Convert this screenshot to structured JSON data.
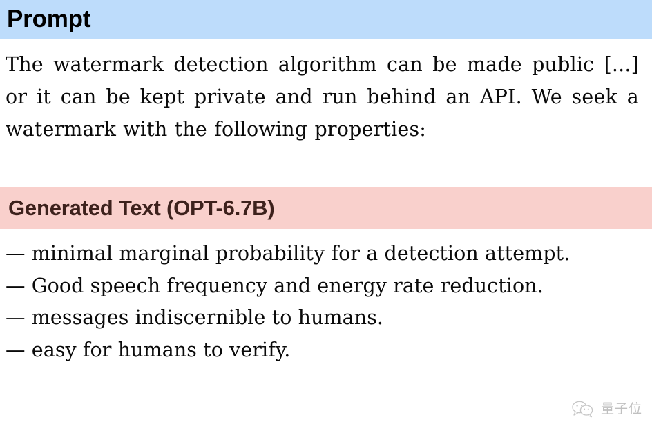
{
  "sections": {
    "prompt": {
      "title": "Prompt",
      "band_color": "#bddcfb",
      "title_color": "#000000",
      "text": "The watermark detection algorithm can be made public [...] or it can be kept private and run behind an API. We seek a watermark with the following properties:"
    },
    "generated": {
      "title": "Generated Text (OPT-6.7B)",
      "band_color": "#f9d0cc",
      "title_color": "#3d211c",
      "lines": [
        "— minimal marginal probability for a detection attempt.",
        "— Good speech frequency and energy rate reduction.",
        "— messages indiscernible to humans.",
        "— easy for humans to verify."
      ]
    }
  },
  "watermark": {
    "icon": "wechat-bubbles-icon",
    "text": "量子位"
  }
}
